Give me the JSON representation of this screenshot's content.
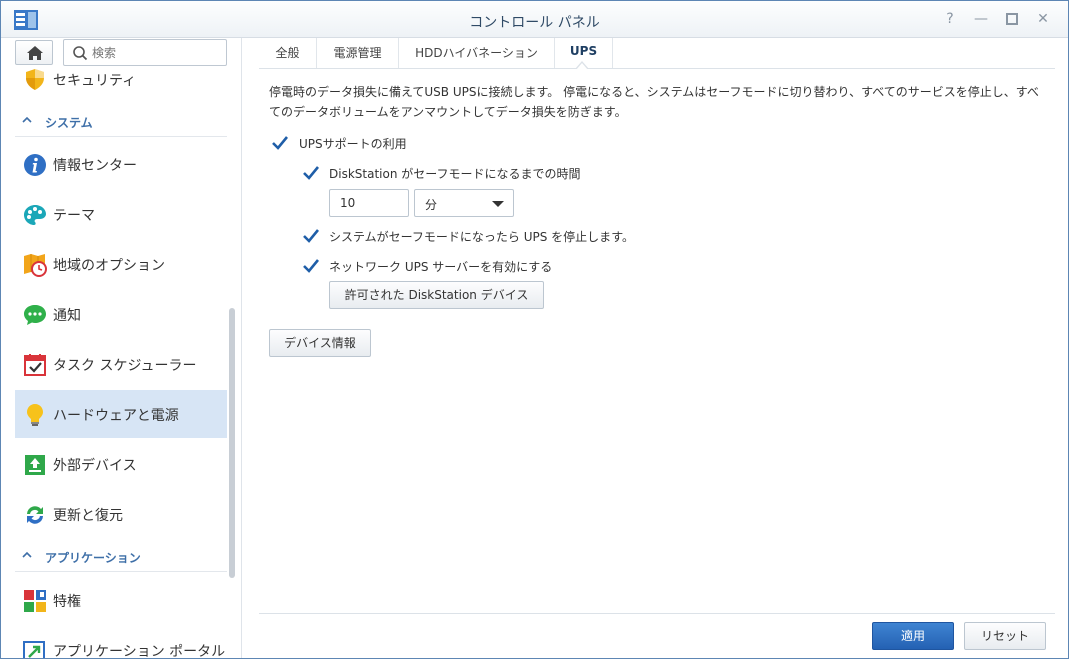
{
  "window": {
    "title": "コントロール パネル"
  },
  "sidebar": {
    "search_placeholder": "検索",
    "items": [
      {
        "label": "セキュリティ"
      },
      {
        "label": "情報センター"
      },
      {
        "label": "テーマ"
      },
      {
        "label": "地域のオプション"
      },
      {
        "label": "通知"
      },
      {
        "label": "タスク スケジューラー"
      },
      {
        "label": "ハードウェアと電源",
        "selected": true
      },
      {
        "label": "外部デバイス"
      },
      {
        "label": "更新と復元"
      },
      {
        "label": "特権"
      },
      {
        "label": "アプリケーション ポータル"
      }
    ],
    "sections": {
      "system": "システム",
      "applications": "アプリケーション"
    }
  },
  "tabs": [
    {
      "label": "全般"
    },
    {
      "label": "電源管理"
    },
    {
      "label": "HDDハイバネーション"
    },
    {
      "label": "UPS",
      "active": true
    }
  ],
  "ups": {
    "description": "停電時のデータ損失に備えてUSB UPSに接続します。 停電になると、システムはセーフモードに切り替わり、すべてのサービスを停止し、すべてのデータボリュームをアンマウントしてデータ損失を防ぎます。",
    "enable_label": "UPSサポートの利用",
    "safe_mode_time_label": "DiskStation がセーフモードになるまでの時間",
    "minutes_value": "10",
    "unit_value": "分",
    "shutdown_ups_label": "システムがセーフモードになったら UPS を停止します。",
    "network_ups_label": "ネットワーク UPS サーバーを有効にする",
    "permitted_devices_button": "許可された DiskStation デバイス",
    "device_info_button": "デバイス情報",
    "enable_checked": true,
    "safe_mode_checked": true,
    "shutdown_checked": true,
    "network_checked": true
  },
  "footer": {
    "apply": "適用",
    "reset": "リセット"
  },
  "colors": {
    "accent": "#2461b3",
    "selected_bg": "#d7e5f5",
    "check": "#1f5ea8"
  }
}
